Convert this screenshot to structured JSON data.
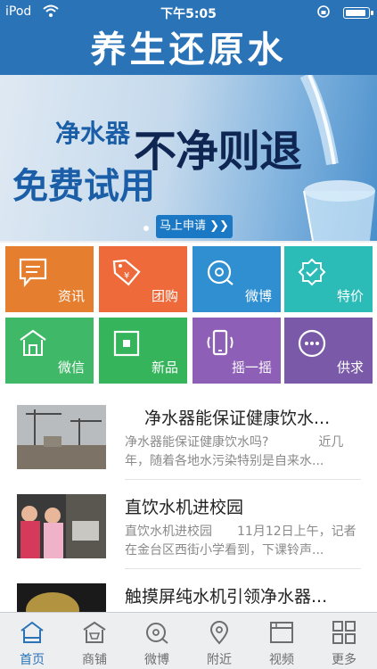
{
  "status_bar": {
    "carrier": "iPod",
    "time": "下午5:05"
  },
  "header": {
    "title": "养生还原水"
  },
  "banner": {
    "line1": "净水器",
    "line2": "免费试用",
    "slogan": "不净则退",
    "cta": "马上申请 ❯❯"
  },
  "grid": [
    {
      "label": "资讯",
      "icon": "chat-bubble-icon",
      "color": "#e57f2f"
    },
    {
      "label": "团购",
      "icon": "price-tag-icon",
      "color": "#ee6a3b"
    },
    {
      "label": "微博",
      "icon": "weibo-icon",
      "color": "#2f8fd0"
    },
    {
      "label": "特价",
      "icon": "badge-icon",
      "color": "#2bbcb8"
    },
    {
      "label": "微信",
      "icon": "storefront-icon",
      "color": "#3fb968"
    },
    {
      "label": "新品",
      "icon": "new-product-icon",
      "color": "#35b45c"
    },
    {
      "label": "摇一摇",
      "icon": "shake-phone-icon",
      "color": "#8e5fb6"
    },
    {
      "label": "供求",
      "icon": "ellipsis-icon",
      "color": "#7a5aa8"
    }
  ],
  "news": [
    {
      "title": "净水器能保证健康饮水...",
      "desc": "净水器能保证健康饮水吗?　　　　近几年，随着各地水污染特别是自来水..."
    },
    {
      "title": "直饮水机进校园",
      "desc": "直饮水机进校园　　11月12日上午，记者在金台区西街小学看到，下课铃声..."
    },
    {
      "title": "触摸屏纯水机引领净水器...",
      "desc": ""
    }
  ],
  "tabs": [
    {
      "label": "首页",
      "icon": "home-icon",
      "active": true
    },
    {
      "label": "商铺",
      "icon": "shop-icon",
      "active": false
    },
    {
      "label": "微博",
      "icon": "weibo-icon",
      "active": false
    },
    {
      "label": "附近",
      "icon": "location-pin-icon",
      "active": false
    },
    {
      "label": "视频",
      "icon": "video-icon",
      "active": false
    },
    {
      "label": "更多",
      "icon": "grid-icon",
      "active": false
    }
  ],
  "colors": {
    "primary": "#2a73b6",
    "tab_active": "#2a73b6",
    "tab_inactive": "#6e6e6e"
  }
}
